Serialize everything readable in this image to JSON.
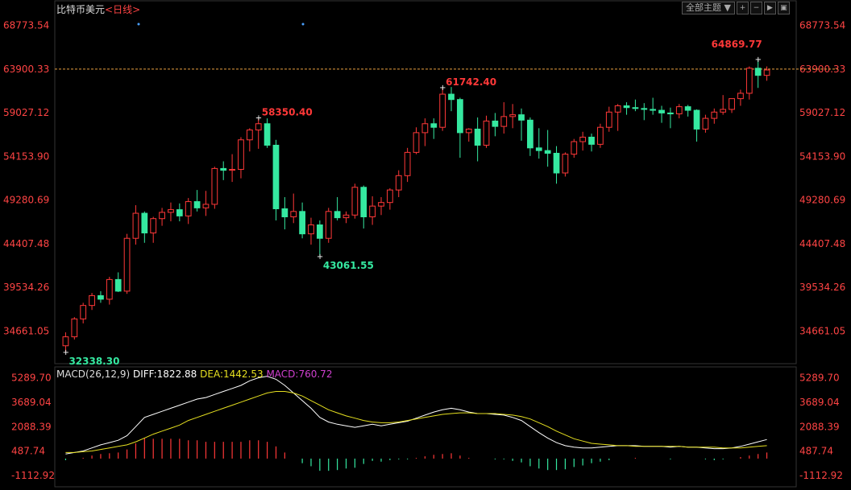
{
  "title": {
    "name": "比特币美元",
    "period": "<日线>"
  },
  "toolbar": {
    "theme_select": "全部主题",
    "buttons": [
      "zoom-in-icon",
      "zoom-out-icon",
      "step-forward-icon",
      "screen-icon"
    ]
  },
  "colors": {
    "up": "#ff3838",
    "down": "#35e8a0",
    "axis_text": "#ff4444",
    "dif": "#ffffff",
    "dea": "#e6e020",
    "macd_label": "#d040d0",
    "price_line": "#e8a040",
    "grid": "#2a2a2a"
  },
  "price_axis": {
    "ticks": [
      "68773.54",
      "63900.33",
      "59027.12",
      "54153.90",
      "49280.69",
      "44407.48",
      "39534.26",
      "34661.05"
    ],
    "current": "63900.33"
  },
  "macd_axis": {
    "ticks": [
      "5289.70",
      "3689.04",
      "2088.39",
      "487.74",
      "-1112.92"
    ]
  },
  "annotations": {
    "high1": "58350.40",
    "high2": "61742.40",
    "high3": "64869.77",
    "low1": "32338.30",
    "low2": "43061.55"
  },
  "macd_legend": {
    "name": "MACD(26,12,9)",
    "diff": "DIFF:1822.88",
    "dea": "DEA:1442.53",
    "macd": "MACD:760.72"
  },
  "chart_data": {
    "type": "candlestick",
    "ylim": [
      31000,
      70000
    ],
    "candles": [
      [
        33000,
        34500,
        32338,
        34000
      ],
      [
        34000,
        36200,
        33700,
        36000
      ],
      [
        36000,
        37800,
        35500,
        37500
      ],
      [
        37500,
        38900,
        37000,
        38600
      ],
      [
        38600,
        39100,
        37800,
        38200
      ],
      [
        38200,
        40700,
        37600,
        40400
      ],
      [
        40400,
        41200,
        39000,
        39100
      ],
      [
        39100,
        45500,
        38800,
        45000
      ],
      [
        45000,
        48700,
        44300,
        47800
      ],
      [
        47800,
        48000,
        44500,
        45600
      ],
      [
        45600,
        47400,
        44500,
        47200
      ],
      [
        47200,
        48400,
        46400,
        47900
      ],
      [
        47900,
        49000,
        46900,
        48200
      ],
      [
        48200,
        48900,
        46900,
        47500
      ],
      [
        47500,
        49500,
        46600,
        49100
      ],
      [
        49100,
        50400,
        48000,
        48400
      ],
      [
        48400,
        50300,
        47500,
        48800
      ],
      [
        48800,
        53000,
        48300,
        52800
      ],
      [
        52800,
        53600,
        51500,
        52600
      ],
      [
        52600,
        54400,
        51300,
        52700
      ],
      [
        52700,
        56300,
        51700,
        56000
      ],
      [
        56000,
        57300,
        54700,
        57100
      ],
      [
        57100,
        58350,
        55000,
        57800
      ],
      [
        57800,
        58400,
        55100,
        55400
      ],
      [
        55400,
        56000,
        47000,
        48300
      ],
      [
        48300,
        49600,
        46000,
        47400
      ],
      [
        47400,
        50000,
        46700,
        48000
      ],
      [
        48000,
        49000,
        45000,
        45500
      ],
      [
        45500,
        47300,
        44300,
        46500
      ],
      [
        46500,
        47000,
        43061,
        45000
      ],
      [
        45000,
        48400,
        44500,
        48000
      ],
      [
        48000,
        49600,
        47000,
        47300
      ],
      [
        47300,
        48000,
        46700,
        47600
      ],
      [
        47600,
        51100,
        47200,
        50700
      ],
      [
        50700,
        50900,
        46100,
        47400
      ],
      [
        47400,
        49700,
        46500,
        48600
      ],
      [
        48600,
        49600,
        47600,
        49000
      ],
      [
        49000,
        50600,
        48200,
        50400
      ],
      [
        50400,
        52600,
        49600,
        52000
      ],
      [
        52000,
        55100,
        51300,
        54600
      ],
      [
        54600,
        57400,
        54400,
        56800
      ],
      [
        56800,
        58400,
        55300,
        57800
      ],
      [
        57800,
        58400,
        56100,
        57400
      ],
      [
        57400,
        61742,
        57000,
        61100
      ],
      [
        61100,
        61900,
        59200,
        60500
      ],
      [
        60500,
        60700,
        54000,
        56800
      ],
      [
        56800,
        57300,
        55800,
        57200
      ],
      [
        57200,
        58500,
        53600,
        55400
      ],
      [
        55400,
        58700,
        55100,
        58100
      ],
      [
        58100,
        59000,
        56400,
        57500
      ],
      [
        57500,
        60200,
        56700,
        58600
      ],
      [
        58600,
        60000,
        57300,
        58800
      ],
      [
        58800,
        59500,
        55900,
        58200
      ],
      [
        58200,
        58500,
        54200,
        55100
      ],
      [
        55100,
        57300,
        53900,
        54800
      ],
      [
        54800,
        57100,
        53000,
        54500
      ],
      [
        54500,
        55300,
        51100,
        52300
      ],
      [
        52300,
        54600,
        51900,
        54400
      ],
      [
        54400,
        56100,
        54000,
        55800
      ],
      [
        55800,
        56900,
        54800,
        56300
      ],
      [
        56300,
        56700,
        54700,
        55500
      ],
      [
        55500,
        57800,
        55100,
        57400
      ],
      [
        57400,
        59700,
        56900,
        59100
      ],
      [
        59100,
        60000,
        57000,
        59800
      ],
      [
        59800,
        60200,
        58800,
        59600
      ],
      [
        59600,
        60500,
        59200,
        59500
      ],
      [
        59500,
        60100,
        58200,
        59400
      ],
      [
        59400,
        60700,
        58800,
        59300
      ],
      [
        59300,
        59800,
        57900,
        59000
      ],
      [
        59000,
        59600,
        57300,
        58900
      ],
      [
        58900,
        60000,
        58400,
        59700
      ],
      [
        59700,
        59900,
        58600,
        59300
      ],
      [
        59300,
        59400,
        55800,
        57200
      ],
      [
        57200,
        58800,
        56800,
        58400
      ],
      [
        58400,
        59500,
        57800,
        59100
      ],
      [
        59100,
        61000,
        58800,
        59400
      ],
      [
        59400,
        60600,
        59000,
        60600
      ],
      [
        60600,
        61600,
        59800,
        61200
      ],
      [
        61200,
        64200,
        60500,
        64000
      ],
      [
        64000,
        64869,
        61800,
        63200
      ],
      [
        63200,
        64200,
        62600,
        63800
      ]
    ],
    "macd": {
      "dif": [
        300,
        400,
        500,
        700,
        900,
        1050,
        1200,
        1500,
        2100,
        2700,
        2900,
        3100,
        3300,
        3500,
        3700,
        3900,
        4000,
        4200,
        4400,
        4600,
        4800,
        5100,
        5300,
        5400,
        5200,
        4800,
        4300,
        3800,
        3300,
        2700,
        2400,
        2250,
        2150,
        2050,
        2150,
        2250,
        2150,
        2250,
        2350,
        2450,
        2650,
        2850,
        3050,
        3200,
        3300,
        3200,
        3050,
        2950,
        2950,
        2900,
        2850,
        2700,
        2500,
        2100,
        1700,
        1350,
        1050,
        850,
        750,
        700,
        700,
        750,
        800,
        850,
        850,
        850,
        800,
        800,
        800,
        750,
        800,
        750,
        750,
        700,
        650,
        650,
        700,
        800,
        950,
        1100,
        1250
      ],
      "dea": [
        400,
        400,
        450,
        500,
        600,
        700,
        800,
        900,
        1100,
        1350,
        1600,
        1800,
        2000,
        2200,
        2500,
        2700,
        2900,
        3100,
        3300,
        3500,
        3700,
        3900,
        4100,
        4300,
        4400,
        4400,
        4300,
        4100,
        3800,
        3500,
        3200,
        3000,
        2800,
        2650,
        2500,
        2400,
        2350,
        2350,
        2400,
        2500,
        2600,
        2700,
        2800,
        2900,
        2950,
        3000,
        3000,
        2950,
        2950,
        2950,
        2900,
        2850,
        2750,
        2600,
        2350,
        2100,
        1800,
        1550,
        1300,
        1150,
        1000,
        950,
        900,
        850,
        850,
        800,
        800,
        800,
        800,
        800,
        800,
        750,
        750,
        750,
        750,
        700,
        700,
        700,
        750,
        800,
        850
      ],
      "hist": [
        -100,
        0,
        50,
        200,
        300,
        350,
        400,
        600,
        1000,
        1350,
        1300,
        1300,
        1300,
        1300,
        1200,
        1200,
        1100,
        1100,
        1100,
        1100,
        1100,
        1200,
        1200,
        1100,
        800,
        400,
        0,
        -300,
        -500,
        -800,
        -800,
        -750,
        -650,
        -600,
        -350,
        -150,
        -200,
        -100,
        -50,
        -50,
        50,
        150,
        250,
        300,
        350,
        200,
        50,
        0,
        0,
        -50,
        -50,
        -150,
        -250,
        -500,
        -650,
        -750,
        -750,
        -700,
        -550,
        -450,
        -300,
        -200,
        -100,
        0,
        0,
        50,
        0,
        0,
        0,
        -50,
        0,
        0,
        0,
        -50,
        -100,
        -50,
        0,
        100,
        200,
        300,
        400
      ]
    },
    "macd_ylim": [
      -1900,
      5800
    ]
  }
}
